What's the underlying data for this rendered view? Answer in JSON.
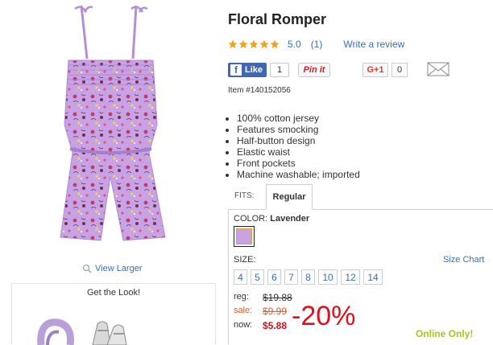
{
  "product": {
    "title": "Floral Romper",
    "rating_value": "5.0",
    "rating_count": "(1)",
    "write_review": "Write a review",
    "item_number": "Item #140152056",
    "view_larger": "View Larger",
    "features": [
      "100% cotton jersey",
      "Features smocking",
      "Half-button design",
      "Elastic waist",
      "Front pockets",
      "Machine washable; imported"
    ]
  },
  "social": {
    "fb_like": "Like",
    "fb_count": "1",
    "pinit": "Pin it",
    "gplus": "G+1",
    "gplus_count": "0"
  },
  "fits": {
    "label": "FITS:",
    "tabs": [
      "Regular"
    ]
  },
  "color": {
    "label": "COLOR:",
    "value": "Lavender",
    "swatch_hex": "#c9a3df"
  },
  "size": {
    "label": "SIZE:",
    "chart_link": "Size Chart",
    "options": [
      "4",
      "5",
      "6",
      "7",
      "8",
      "10",
      "12",
      "14"
    ]
  },
  "pricing": {
    "reg_label": "reg:",
    "reg_price": "$19.88",
    "sale_label": "sale:",
    "sale_price": "$9.99",
    "now_label": "now:",
    "now_price": "$5.88",
    "discount": "-20%",
    "online_only": "Online Only!"
  },
  "get_the_look": {
    "title": "Get the Look!"
  },
  "colors": {
    "link": "#3a6fb0",
    "sale": "#e05c2b",
    "discount": "#e0101b",
    "online_only": "#a7c81a",
    "star": "#f0a21b"
  },
  "rating": {
    "stars": 5
  }
}
